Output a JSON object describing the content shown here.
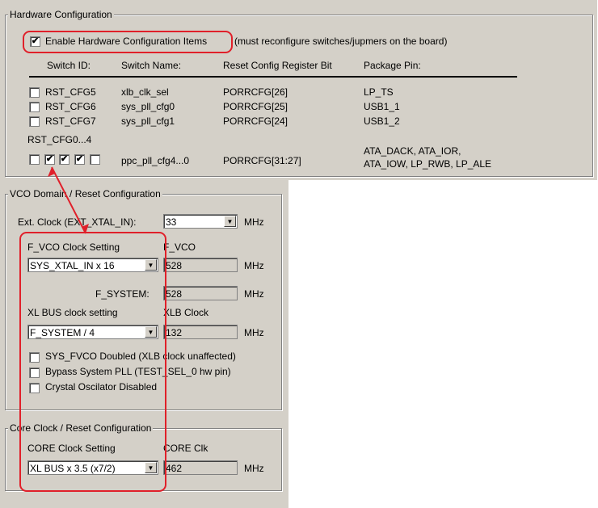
{
  "hardware_config": {
    "legend": "Hardware Configuration",
    "enable_label": "Enable Hardware Configuration Items",
    "enable_note": "(must reconfigure switches/jupmers on the board)",
    "columns": [
      "Switch ID:",
      "Switch Name:",
      "Reset Config Register Bit",
      "Package Pin:"
    ],
    "rows": [
      {
        "id": "RST_CFG5",
        "name": "xlb_clk_sel",
        "bit": "PORRCFG[26]",
        "pin": "LP_TS"
      },
      {
        "id": "RST_CFG6",
        "name": "sys_pll_cfg0",
        "bit": "PORRCFG[25]",
        "pin": "USB1_1"
      },
      {
        "id": "RST_CFG7",
        "name": "sys_pll_cfg1",
        "bit": "PORRCFG[24]",
        "pin": "USB1_2"
      }
    ],
    "multi_row": {
      "id": "RST_CFG0...4",
      "name": "ppc_pll_cfg4...0",
      "bit": "PORRCFG[31:27]",
      "pin_line1": "ATA_DACK, ATA_IOR,",
      "pin_line2": "ATA_IOW, LP_RWB, LP_ALE"
    }
  },
  "vco": {
    "legend": "VCO Domain / Reset Configuration",
    "ext_clock_label": "Ext. Clock (EXT_XTAL_IN):",
    "ext_clock_value": "33",
    "mhz": "MHz",
    "fvco_setting_label": "F_VCO Clock Setting",
    "fvco_setting_value": "SYS_XTAL_IN x 16",
    "fvco_label": "F_VCO",
    "fvco_value": "528",
    "fsystem_label": "F_SYSTEM:",
    "fsystem_value": "528",
    "xlbus_setting_label": "XL BUS clock setting",
    "xlbus_setting_value": "F_SYSTEM / 4",
    "xlb_clock_label": "XLB Clock",
    "xlb_clock_value": "132",
    "opt1": "SYS_FVCO Doubled (XLB clock unaffected)",
    "opt2": "Bypass System PLL (TEST_SEL_0 hw pin)",
    "opt3": "Crystal Oscilator Disabled"
  },
  "core": {
    "legend": "Core Clock / Reset Configuration",
    "setting_label": "CORE Clock Setting",
    "setting_value": "XL BUS x 3.5 (x7/2)",
    "clk_label": "CORE Clk",
    "clk_value": "462",
    "mhz": "MHz"
  },
  "colors": {
    "annotation": "#e0202a",
    "dialog_bg": "#d4d0c8"
  }
}
